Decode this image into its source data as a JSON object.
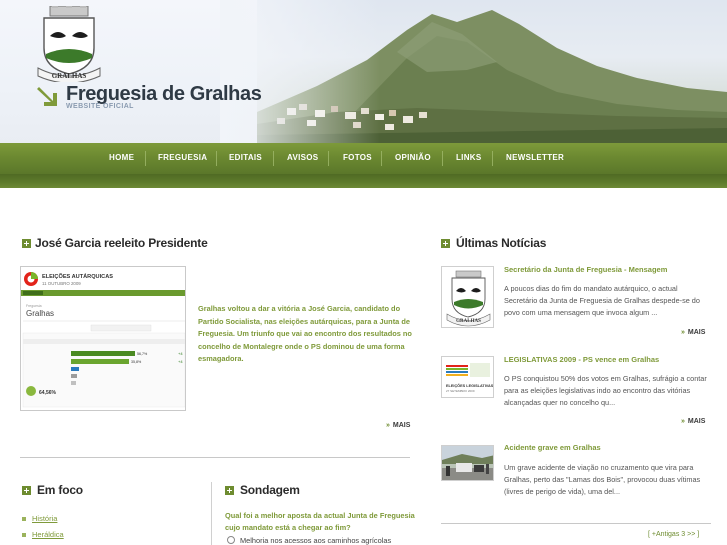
{
  "header": {
    "title": "Freguesia de Gralhas",
    "subtitle": "WEBSITE OFICIAL",
    "crest_text": "GRALHAS"
  },
  "nav": {
    "items": [
      {
        "label": "HOME"
      },
      {
        "label": "FREGUESIA"
      },
      {
        "label": "EDITAIS"
      },
      {
        "label": "AVISOS"
      },
      {
        "label": "FOTOS"
      },
      {
        "label": "OPINIÃO"
      },
      {
        "label": "LINKS"
      },
      {
        "label": "NEWSLETTER"
      }
    ]
  },
  "feature": {
    "heading": "José Garcia reeleito Presidente",
    "text": "Gralhas voltou a dar a vitória a José Garcia, candidato do Partido Socialista, nas eleições autárquicas, para a Junta de Freguesia. Um triunfo que vai ao encontro dos resultados no concelho de Montalegre onde o PS dominou de uma forma esmagadora.",
    "more_label": "MAIS",
    "thumb": {
      "banner": "ELEIÇÕES AUTÁRQUICAS",
      "date": "11 OUTUBRO 2009",
      "place": "Gralhas",
      "pct_main": "64,56%"
    }
  },
  "news": {
    "heading": "Últimas Notícias",
    "items": [
      {
        "title": "Secretário da Junta de Freguesia - Mensagem",
        "body": "A poucos dias do fim do mandato autárquico, o actual Secretário da Junta de Freguesia de Gralhas despede-se do povo com uma mensagem que invoca algum ...",
        "more_label": "MAIS",
        "thumb_caption": "GRALHAS"
      },
      {
        "title": "LEGISLATIVAS 2009 - PS vence em Gralhas",
        "body": "O PS conquistou 50% dos votos em Gralhas, sufrágio a contar para as eleições legislativas indo ao encontro das vitórias alcançadas quer no concelho qu...",
        "more_label": "MAIS",
        "thumb_caption": "ELEIÇÕES LEGISLATIVAS"
      },
      {
        "title": "Acidente grave em Gralhas",
        "body": "Um grave acidente de viação no cruzamento que vira para Gralhas, perto das \"Lamas dos Bois\", provocou duas vítimas (livres de perigo de vida), uma del...",
        "more_label": "MAIS"
      }
    ],
    "older_label": "[ +Antigas 3 >> ]"
  },
  "foco": {
    "heading": "Em foco",
    "items": [
      {
        "label": "História"
      },
      {
        "label": "Heráldica"
      }
    ]
  },
  "poll": {
    "heading": "Sondagem",
    "question": "Qual foi a melhor aposta da actual Junta de Freguesia cujo mandato está a chegar ao fim?",
    "options": [
      {
        "label": "Melhoria nos acessos aos caminhos agrícolas"
      }
    ]
  },
  "colors": {
    "accent": "#7f9a3a",
    "nav": "#6a8730",
    "heading": "#2b2b2b"
  }
}
